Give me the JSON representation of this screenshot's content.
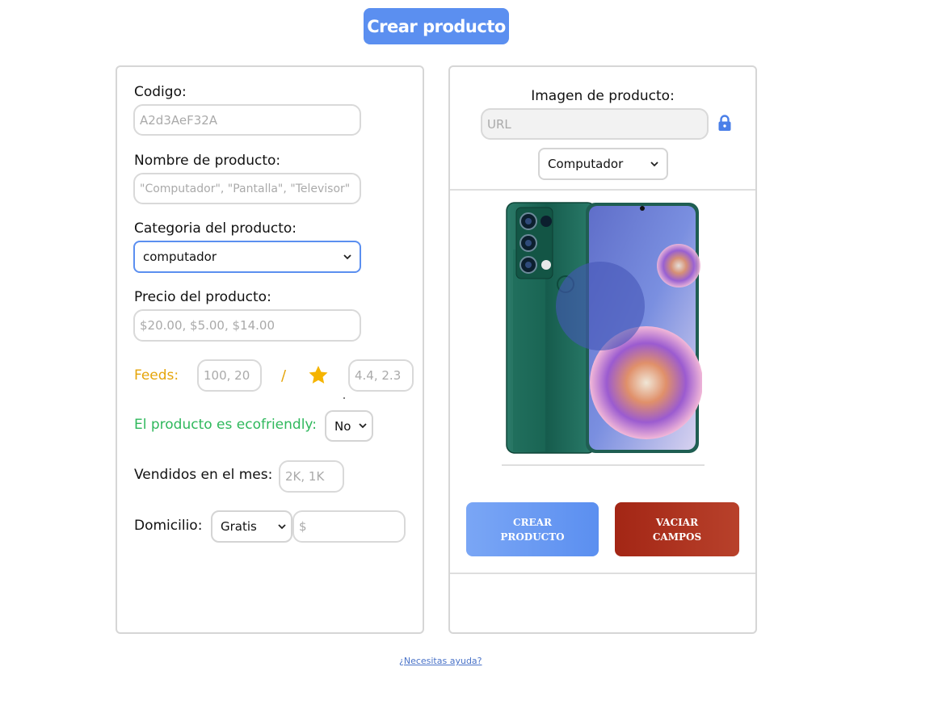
{
  "header": {
    "title": "Crear producto"
  },
  "form": {
    "code_label": "Codigo:",
    "code_placeholder": "A2d3AeF32A",
    "name_label": "Nombre de producto:",
    "name_placeholder": "\"Computador\", \"Pantalla\", \"Televisor\"",
    "category_label": "Categoria del producto:",
    "category_value": "computador",
    "price_label": "Precio del producto:",
    "price_placeholder": "$20.00, $5.00, $14.00",
    "feeds_label": "Feeds:",
    "feeds_placeholder": "100, 20",
    "feeds_separator": "/",
    "rating_placeholder": "4.4, 2.3",
    "eco_label": "El producto es ecofriendly:",
    "eco_value": "No",
    "sold_label": "Vendidos en el mes:",
    "sold_placeholder": "2K, 1K",
    "delivery_label": "Domicilio:",
    "delivery_value": "Gratis",
    "delivery_price_placeholder": "$"
  },
  "image_panel": {
    "label": "Imagen de producto:",
    "url_placeholder": "URL",
    "type_value": "Computador"
  },
  "actions": {
    "create_line1": "CREAR",
    "create_line2": "PRODUCTO",
    "clear_line1": "VACIAR",
    "clear_line2": "CAMPOS"
  },
  "footer": {
    "help_link": "¿Necesitas ayuda?"
  },
  "colors": {
    "accent": "#5b8ff0",
    "feeds": "#e5a50a",
    "eco": "#2fb85c",
    "danger": "#a32615"
  },
  "icons": [
    "star-icon",
    "lock-icon",
    "chevron-down-icon"
  ]
}
